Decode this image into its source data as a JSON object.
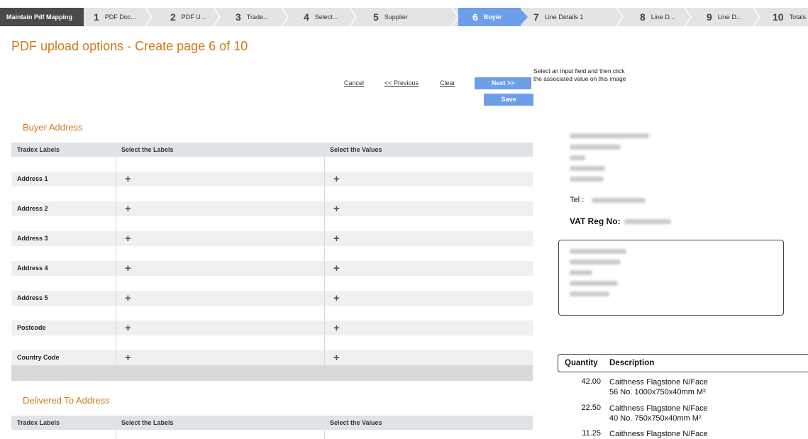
{
  "wizard": {
    "title": "Maintain Pdf Mapping",
    "steps": [
      {
        "num": "1",
        "label": "PDF Doc..."
      },
      {
        "num": "2",
        "label": "PDF U..."
      },
      {
        "num": "3",
        "label": "Trade..."
      },
      {
        "num": "4",
        "label": "Select..."
      },
      {
        "num": "5",
        "label": "Supplier"
      },
      {
        "num": "6",
        "label": "Buyer",
        "active": true
      },
      {
        "num": "7",
        "label": "Line Details 1"
      },
      {
        "num": "8",
        "label": "Line D..."
      },
      {
        "num": "9",
        "label": "Line D..."
      },
      {
        "num": "10",
        "label": "Totals"
      }
    ],
    "active_color": "#6d9ee8"
  },
  "page": {
    "title": "PDF upload options - Create page 6 of 10"
  },
  "actions": {
    "cancel": "Cancel",
    "previous": "<< Previous",
    "clear": "Clear",
    "next": "Next >>",
    "save": "Save",
    "help": "Select an input field and then click the associated value on this image"
  },
  "buyer_address": {
    "title": "Buyer Address",
    "headers": [
      "Tradex Labels",
      "Select the Labels",
      "Select the Values"
    ],
    "rows": [
      "Address 1",
      "Address 2",
      "Address 3",
      "Address 4",
      "Address 5",
      "Postcode",
      "Country Code"
    ]
  },
  "delivered_address": {
    "title": "Delivered To Address",
    "headers": [
      "Tradex Labels",
      "Select the Labels",
      "Select the Values"
    ]
  },
  "preview": {
    "tel_label": "Tel :",
    "vat_label": "VAT Reg No:",
    "quantity_header": "Quantity",
    "description_header": "Description",
    "lines": [
      {
        "qty": "42.00",
        "desc1": "Caithness Flagstone N/Face",
        "desc2": "56 No. 1000x750x40mm M²"
      },
      {
        "qty": "22.50",
        "desc1": "Caithness Flagstone N/Face",
        "desc2": "40 No. 750x750x40mm M²"
      },
      {
        "qty": "11.25",
        "desc1": "Caithness Flagstone N/Face",
        "desc2": ""
      }
    ]
  }
}
